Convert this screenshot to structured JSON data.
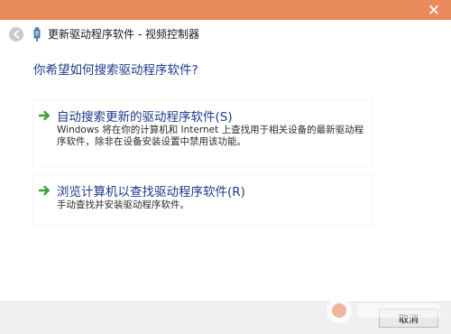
{
  "window": {
    "title": "更新驱动程序软件 - 视频控制器",
    "close_glyph": "✕"
  },
  "question": "你希望如何搜索驱动程序软件?",
  "options": [
    {
      "title": "自动搜索更新的驱动程序软件(S)",
      "description": "Windows 将在你的计算机和 Internet 上查找用于相关设备的最新驱动程序软件，除非在设备安装设置中禁用该功能。"
    },
    {
      "title": "浏览计算机以查找驱动程序软件(R)",
      "description": "手动查找并安装驱动程序软件。"
    }
  ],
  "footer": {
    "cancel_label": "取消"
  },
  "colors": {
    "accent_orange": "#ea8b5e",
    "link_blue": "#1e3b8a",
    "arrow_green": "#3aa13a"
  },
  "icons": [
    "close-icon",
    "back-arrow-icon",
    "device-icon",
    "green-arrow-icon"
  ]
}
